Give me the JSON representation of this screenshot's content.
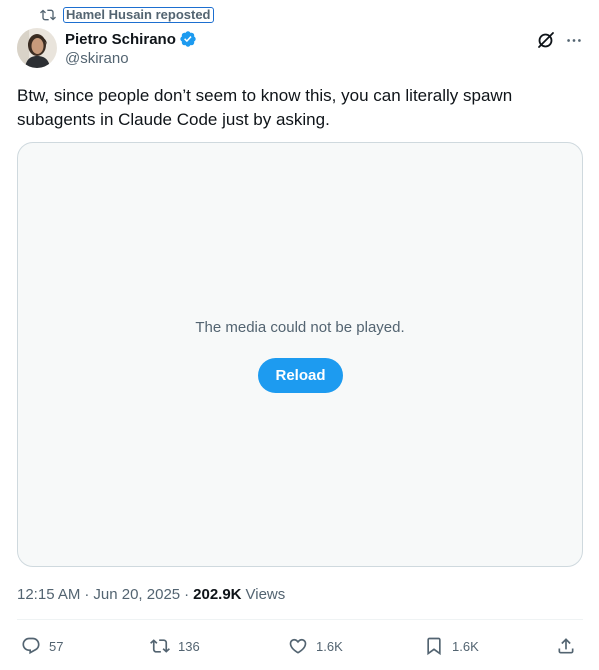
{
  "repost": {
    "label": "Hamel Husain reposted",
    "icon": "repost-icon"
  },
  "author": {
    "name": "Pietro Schirano",
    "handle": "@skirano",
    "verified": true,
    "verified_color": "#1d9bf0"
  },
  "tweet": {
    "text": "Btw, since people don’t seem to know this, you can literally spawn subagents in Claude Code just by asking."
  },
  "media": {
    "message": "The media could not be played.",
    "reload_label": "Reload"
  },
  "meta": {
    "time": "12:15 AM",
    "date": "Jun 20, 2025",
    "views_count": "202.9K",
    "views_label": "Views"
  },
  "actions": {
    "replies": "57",
    "reposts": "136",
    "likes": "1.6K",
    "bookmarks": "1.6K"
  },
  "colors": {
    "accent": "#1d9bf0",
    "text_primary": "#0f1419",
    "text_secondary": "#536471",
    "border": "#cfd9de"
  }
}
